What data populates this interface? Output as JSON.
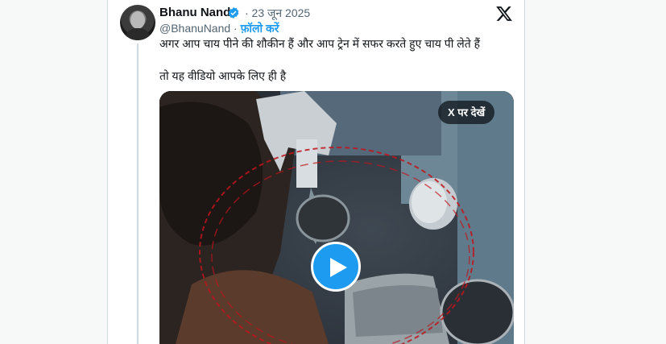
{
  "tweet": {
    "author_name": "Bhanu Nand",
    "verified": true,
    "date": "· 23 जून 2025",
    "handle": "@BhanuNand",
    "separator": " · ",
    "follow_label": "फ़ॉलो करें",
    "text_line1": "अगर आप चाय पीने की शौकीन हैं और आप ट्रेन में सफर करते हुए चाय पी लेते हैं",
    "text_line2": "तो यह वीडियो आपके लिए ही है",
    "media": {
      "watch_on_x_label": "X पर देखें",
      "play_icon": "play-icon"
    }
  },
  "colors": {
    "accent": "#1d9bf0",
    "text": "#0f1419",
    "secondary": "#536471",
    "border": "#cfd9de"
  }
}
